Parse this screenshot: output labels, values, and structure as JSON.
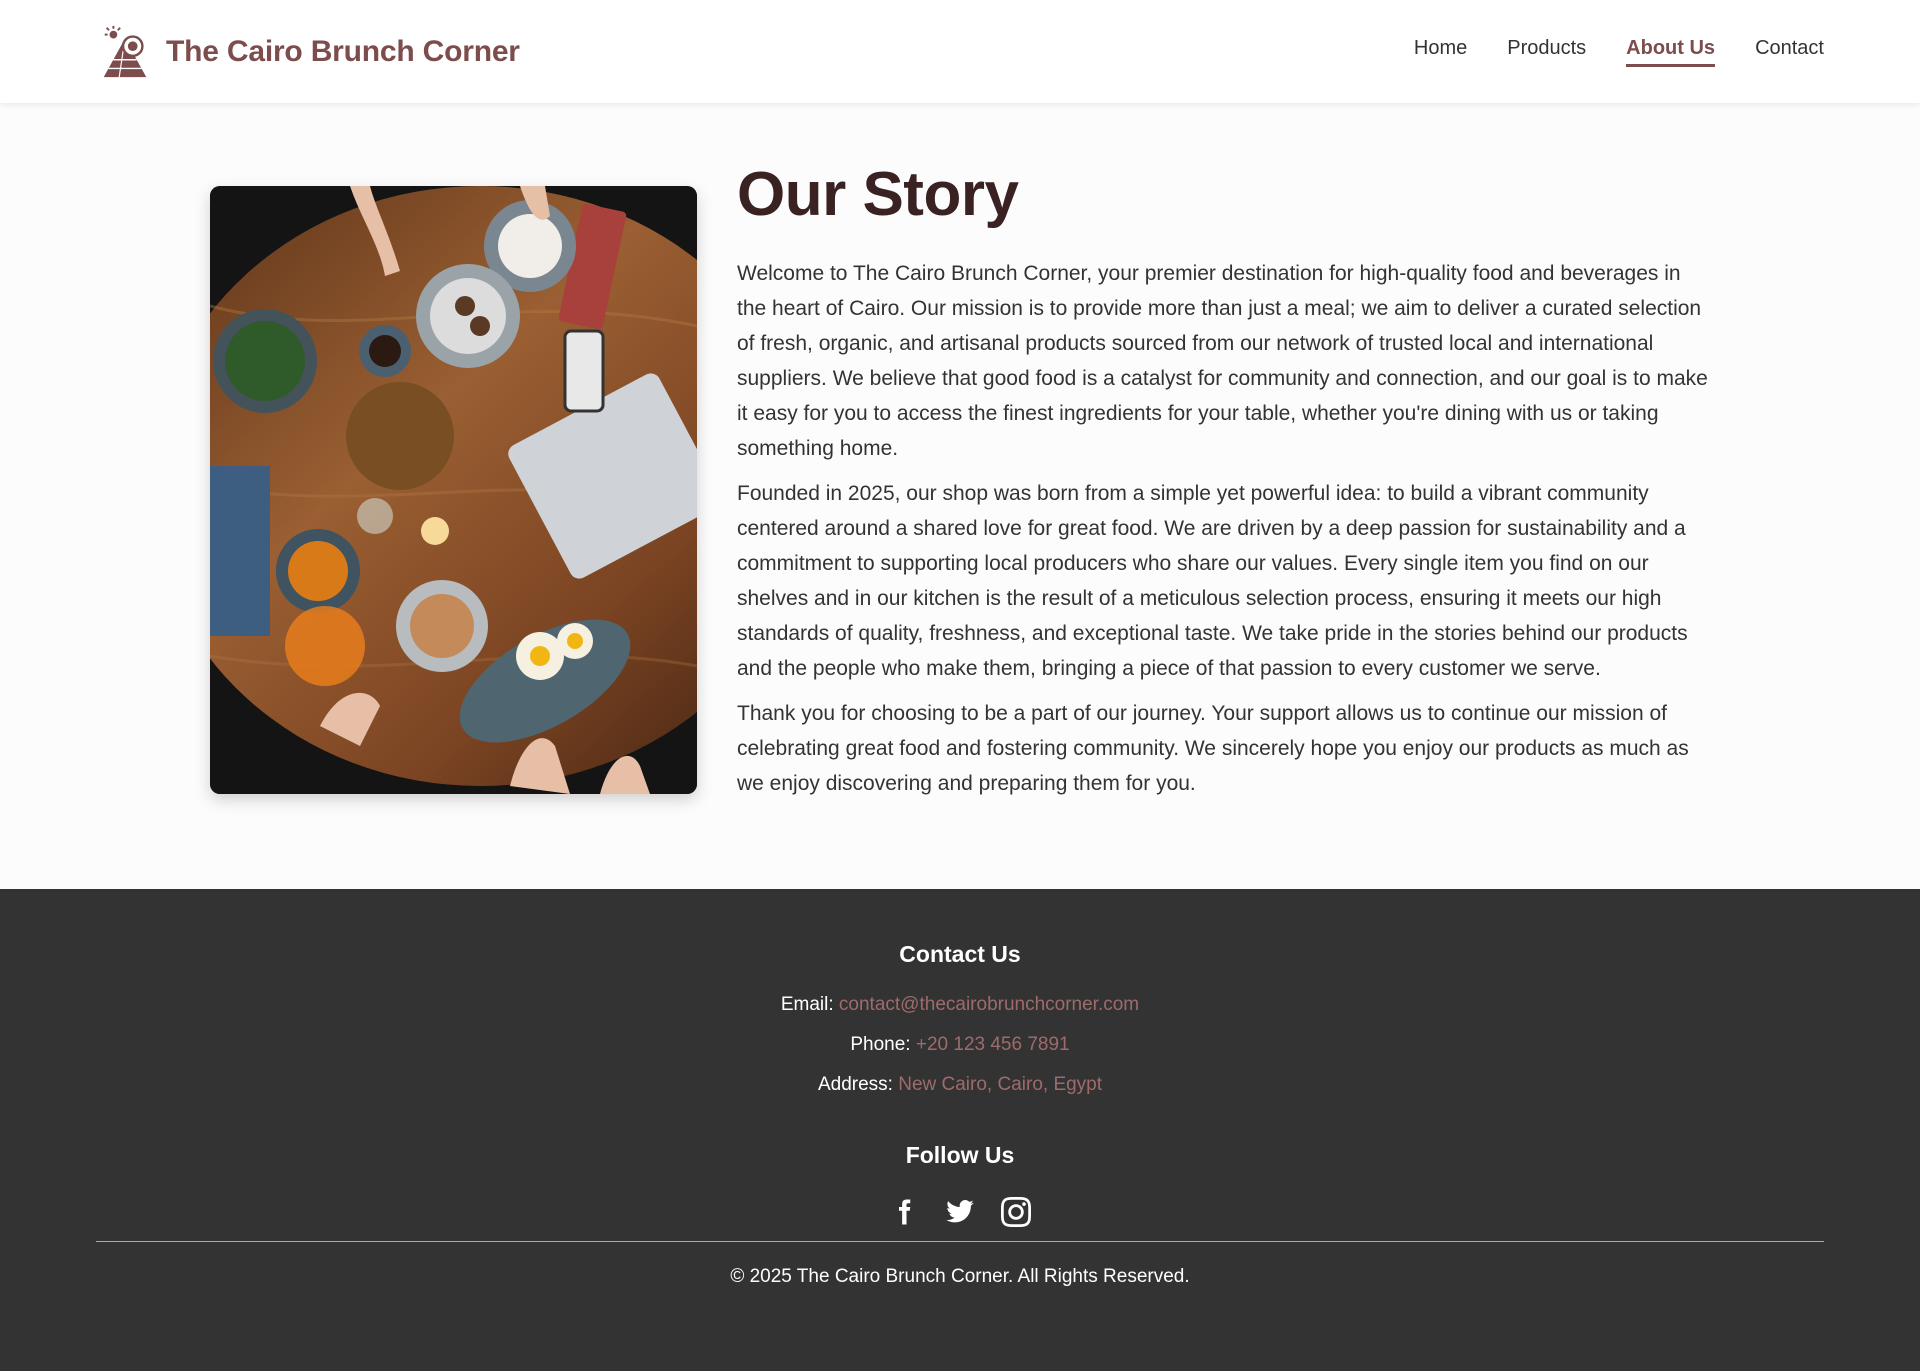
{
  "header": {
    "brand_name": "The Cairo Brunch Corner",
    "logo_icon": "pyramid-sun-icon",
    "nav": [
      {
        "label": "Home",
        "active": false
      },
      {
        "label": "Products",
        "active": false
      },
      {
        "label": "About Us",
        "active": true
      },
      {
        "label": "Contact",
        "active": false
      }
    ]
  },
  "main": {
    "image_icon": "brunch-table-photo",
    "title": "Our Story",
    "paragraphs": [
      "Welcome to The Cairo Brunch Corner, your premier destination for high-quality food and beverages in the heart of Cairo. Our mission is to provide more than just a meal; we aim to deliver a curated selection of fresh, organic, and artisanal products sourced from our network of trusted local and international suppliers. We believe that good food is a catalyst for community and connection, and our goal is to make it easy for you to access the finest ingredients for your table, whether you're dining with us or taking something home.",
      "Founded in 2025, our shop was born from a simple yet powerful idea: to build a vibrant community centered around a shared love for great food. We are driven by a deep passion for sustainability and a commitment to supporting local producers who share our values. Every single item you find on our shelves and in our kitchen is the result of a meticulous selection process, ensuring it meets our high standards of quality, freshness, and exceptional taste. We take pride in the stories behind our products and the people who make them, bringing a piece of that passion to every customer we serve.",
      "Thank you for choosing to be a part of our journey. Your support allows us to continue our mission of celebrating great food and fostering community. We sincerely hope you enjoy our products as much as we enjoy discovering and preparing them for you."
    ]
  },
  "footer": {
    "contact_title": "Contact Us",
    "email_label": "Email:",
    "email_value": "contact@thecairobrunchcorner.com",
    "phone_label": "Phone:",
    "phone_value": "+20 123 456 7891",
    "address_label": "Address:",
    "address_value": "New Cairo, Cairo, Egypt",
    "follow_title": "Follow Us",
    "socials": [
      "facebook-icon",
      "twitter-icon",
      "instagram-icon"
    ],
    "copyright": "© 2025 The Cairo Brunch Corner. All Rights Reserved."
  },
  "colors": {
    "brand": "#7d4c4c",
    "footer_bg": "#333333",
    "footer_link": "#9e6b6b",
    "title": "#3a2222"
  }
}
